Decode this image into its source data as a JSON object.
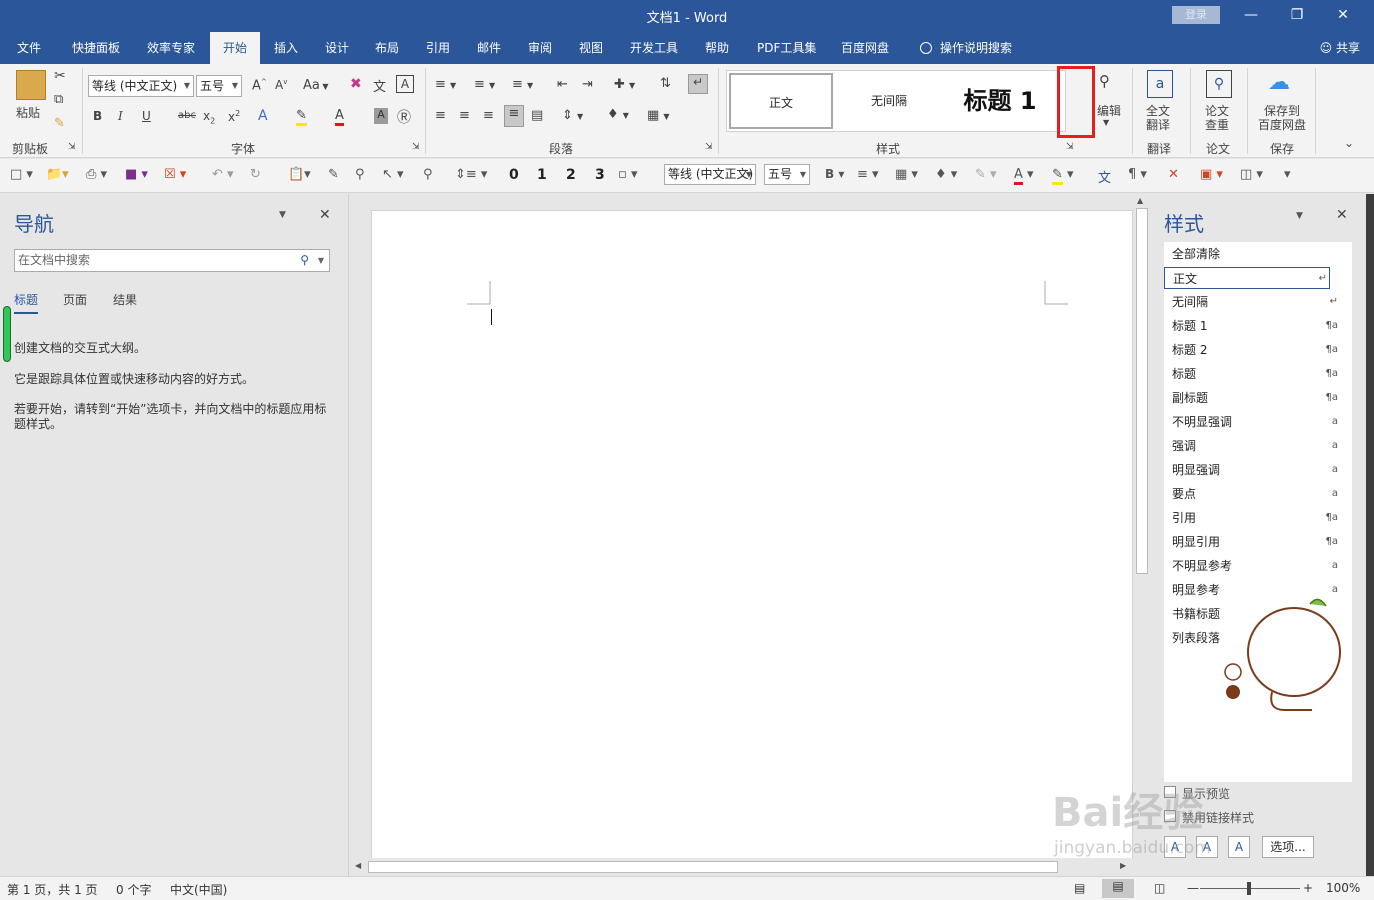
{
  "window": {
    "title": "文档1  -  Word",
    "login": "登录"
  },
  "tabs": [
    "文件",
    "快捷面板",
    "效率专家",
    "开始",
    "插入",
    "设计",
    "布局",
    "引用",
    "邮件",
    "审阅",
    "视图",
    "开发工具",
    "帮助",
    "PDF工具集",
    "百度网盘"
  ],
  "tell_me": "操作说明搜索",
  "share": "共享",
  "ribbon": {
    "paste": "粘贴",
    "clipboard": "剪贴板",
    "font_name": "等线 (中文正文)",
    "font_size": "五号",
    "aa": "Aa",
    "font_group": "字体",
    "paragraph_group": "段落",
    "styles_group": "样式",
    "gallery": [
      "正文",
      "无间隔",
      "标题 1"
    ],
    "edit": "编辑",
    "translate_btn": "全文\n翻译",
    "translate_group": "翻译",
    "paper_btn": "论文\n查重",
    "paper_group": "论文",
    "save_btn": "保存到\n百度网盘",
    "save_group": "保存"
  },
  "qat": {
    "nums": [
      "0",
      "1",
      "2",
      "3"
    ],
    "font": "等线 (中文正文)",
    "size": "五号"
  },
  "nav": {
    "title": "导航",
    "search_placeholder": "在文档中搜索",
    "tabs": [
      "标题",
      "页面",
      "结果"
    ],
    "text1": "创建文档的交互式大纲。",
    "text2": "它是跟踪具体位置或快速移动内容的好方式。",
    "text3": "若要开始，请转到“开始”选项卡，并向文档中的标题应用标题样式。"
  },
  "styles": {
    "title": "样式",
    "items": [
      {
        "name": "全部清除",
        "mark": ""
      },
      {
        "name": "正文",
        "mark": "↵"
      },
      {
        "name": "无间隔",
        "mark": "↵"
      },
      {
        "name": "标题 1",
        "mark": "¶a"
      },
      {
        "name": "标题 2",
        "mark": "¶a"
      },
      {
        "name": "标题",
        "mark": "¶a"
      },
      {
        "name": "副标题",
        "mark": "¶a"
      },
      {
        "name": "不明显强调",
        "mark": "a"
      },
      {
        "name": "强调",
        "mark": "a"
      },
      {
        "name": "明显强调",
        "mark": "a"
      },
      {
        "name": "要点",
        "mark": "a"
      },
      {
        "name": "引用",
        "mark": "¶a"
      },
      {
        "name": "明显引用",
        "mark": "¶a"
      },
      {
        "name": "不明显参考",
        "mark": "a"
      },
      {
        "name": "明显参考",
        "mark": "a"
      },
      {
        "name": "书籍标题",
        "mark": ""
      },
      {
        "name": "列表段落",
        "mark": ""
      }
    ],
    "show_preview": "显示预览",
    "disable_linked": "禁用链接样式",
    "options": "选项..."
  },
  "status": {
    "page": "第 1 页，共 1 页",
    "words": "0 个字",
    "lang": "中文(中国)",
    "zoom": "100%"
  },
  "watermark": "Bai经验",
  "watermark_url": "jingyan.baidu.com"
}
